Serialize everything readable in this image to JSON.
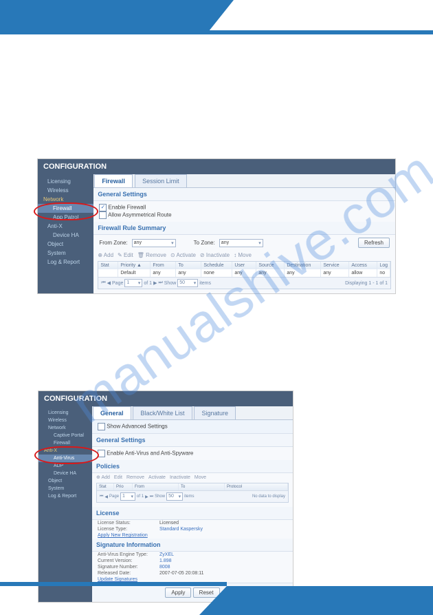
{
  "watermark": "manualshive.com",
  "nav_title": "CONFIGURATION",
  "side": {
    "licensing": "Licensing",
    "wireless": "Wireless",
    "network": "Network",
    "firewall": "Firewall",
    "apppatrol": "App Patrol",
    "antix": "Anti-X",
    "deviceha": "Device HA",
    "object": "Object",
    "system": "System",
    "logreport": "Log & Report",
    "captive": "Captive Portal",
    "antivirus": "Anti-Virus",
    "adp": "ADP",
    "antix2": "Anti-X"
  },
  "s1": {
    "tabs": {
      "firewall": "Firewall",
      "session": "Session Limit"
    },
    "gs": {
      "title": "General Settings",
      "enable": "Enable Firewall",
      "asym": "Allow Asymmetrical Route"
    },
    "frs": {
      "title": "Firewall Rule Summary",
      "from": "From Zone:",
      "to": "To Zone:",
      "any": "any",
      "refresh": "Refresh"
    },
    "tool": {
      "add": "Add",
      "edit": "Edit",
      "remove": "Remove",
      "activate": "Activate",
      "inactivate": "Inactivate",
      "move": "Move"
    },
    "cols": {
      "stat": "Stat",
      "pri": "Priority",
      "from": "From",
      "to": "To",
      "sched": "Schedule",
      "user": "User",
      "source": "Source",
      "dest": "Destination",
      "service": "Service",
      "access": "Access",
      "log": "Log"
    },
    "row": {
      "stat": "",
      "pri": "Default",
      "from": "any",
      "to": "any",
      "sched": "none",
      "user": "any",
      "source": "any",
      "dest": "any",
      "service": "any",
      "access": "allow",
      "log": "no"
    },
    "pager": {
      "page": "Page",
      "of": "of 1",
      "show": "Show",
      "items": "items",
      "disp": "Displaying 1 - 1 of 1",
      "pg": "1",
      "sz": "50"
    }
  },
  "s2": {
    "tabs": {
      "general": "General",
      "bw": "Black/White List",
      "sig": "Signature"
    },
    "showadv": "Show Advanced Settings",
    "gs": {
      "title": "General Settings",
      "enable": "Enable Anti-Virus and Anti-Spyware"
    },
    "pol": {
      "title": "Policies"
    },
    "tool": {
      "add": "Add",
      "edit": "Edit",
      "remove": "Remove",
      "activate": "Activate",
      "inactivate": "Inactivate",
      "move": "Move"
    },
    "cols": {
      "stat": "Stat",
      "pri": "Prio",
      "from": "From",
      "to": "To",
      "proto": "Protocol"
    },
    "nodata": "No data to display",
    "pager": {
      "page": "Page",
      "of": "of 1",
      "show": "Show",
      "items": "items",
      "pg": "1",
      "sz": "50"
    },
    "lic": {
      "title": "License",
      "status_l": "License Status:",
      "status_v": "Licensed",
      "type_l": "License Type:",
      "type_v": "Standard Kaspersky",
      "apply": "Apply New Registration"
    },
    "sig": {
      "title": "Signature Information",
      "eng_l": "Anti-Virus Engine Type:",
      "eng_v": "ZyXEL",
      "ver_l": "Current Version:",
      "ver_v": "1.898",
      "num_l": "Signature Number:",
      "num_v": "8008",
      "date_l": "Released Date:",
      "date_v": "2007-07-05 20:08:11",
      "upd": "Update Signatures"
    },
    "btns": {
      "apply": "Apply",
      "reset": "Reset"
    }
  }
}
